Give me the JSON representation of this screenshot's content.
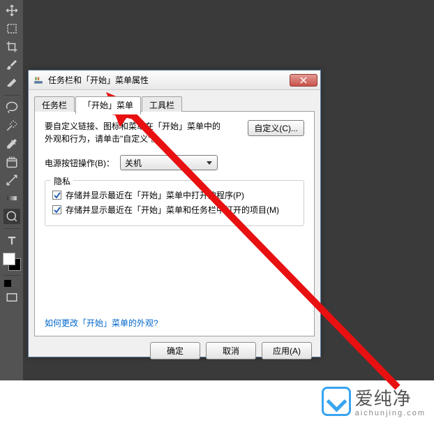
{
  "dialog": {
    "title": "任务栏和「开始」菜单属性",
    "tabs": {
      "taskbar": "任务栏",
      "startmenu": "「开始」菜单",
      "toolbars": "工具栏"
    },
    "desc": "要自定义链接、图标和菜单在「开始」菜单中的外观和行为，请单击\"自定义\"。",
    "customize_btn": "自定义(C)...",
    "power_label": "电源按钮操作(B)：",
    "power_value": "关机",
    "privacy": {
      "legend": "隐私",
      "opt1": "存储并显示最近在「开始」菜单中打开的程序(P)",
      "opt2": "存储并显示最近在「开始」菜单和任务栏中打开的项目(M)"
    },
    "link": "如何更改「开始」菜单的外观?",
    "buttons": {
      "ok": "确定",
      "cancel": "取消",
      "apply": "应用(A)"
    }
  },
  "watermark": {
    "text_cn": "爱纯净",
    "domain_pre": "aichunjing",
    "domain_suf": ".com"
  }
}
